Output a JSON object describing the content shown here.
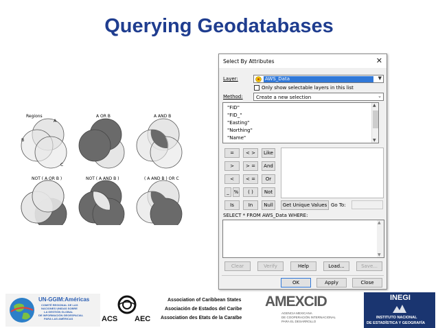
{
  "slide": {
    "title": "Querying Geodatabases"
  },
  "venn": {
    "labels": [
      "Regions",
      "A",
      "B",
      "C",
      "A  OR  B",
      "A  AND  B",
      "NOT ( A  OR  B )",
      "NOT ( A  AND  B )",
      "( A  AND  B ) OR  C"
    ]
  },
  "dialog": {
    "title": "Select By Attributes",
    "close_glyph": "✕",
    "layer_label": "Layer:",
    "layer_value": "AWS_Data",
    "only_selectable_label": "Only show selectable layers in this list",
    "method_label": "Method:",
    "method_value": "Create a new selection",
    "fields": [
      "\"FID\"",
      "\"FID_\"",
      "\"Easting\"",
      "\"Northing\"",
      "\"Name\""
    ],
    "operators": [
      "=",
      "< >",
      "Like",
      ">",
      "> =",
      "And",
      "<",
      "< =",
      "Or",
      "_",
      "%",
      "( )",
      "Not",
      "Is",
      "In",
      "Null"
    ],
    "get_unique_values": "Get Unique Values",
    "go_to_label": "Go To:",
    "sql_prefix": "SELECT * FROM AWS_Data WHERE:",
    "buttons": {
      "clear": "Clear",
      "verify": "Verify",
      "help": "Help",
      "load": "Load...",
      "save": "Save...",
      "ok": "OK",
      "apply": "Apply",
      "close": "Close"
    }
  },
  "logos": {
    "ungigim": "UN-GGIM:Américas",
    "ungigim_sub": [
      "COMITÉ REGIONAL DE LAS",
      "NACIONES UNIDAS SOBRE",
      "LA GESTIÓN GLOBAL",
      "DE INFORMACIÓN GEOESPACIAL",
      "PARA LAS AMÉRICAS"
    ],
    "acs_left": "ACS",
    "acs_right": "AEC",
    "acs_names": [
      "Association of Caribbean States",
      "Asociación de Estados del Caribe",
      "Association des Etats de  la Caraïbe"
    ],
    "amexcid": "AMEXCID",
    "amexcid_sub": [
      "AGENCIA MEXICANA",
      "DE COOPERACIÓN INTERNACIONAL",
      "PARA EL DESARROLLO"
    ],
    "inegi": "INEGI",
    "inegi_sub": [
      "INSTITUTO NACIONAL",
      "DE ESTADÍSTICA Y GEOGRAFÍA"
    ]
  },
  "colors": {
    "title": "#1f3d8f",
    "venn_light": "#e0e0e0",
    "venn_dark": "#6a6a6a",
    "selection": "#3078d8"
  }
}
